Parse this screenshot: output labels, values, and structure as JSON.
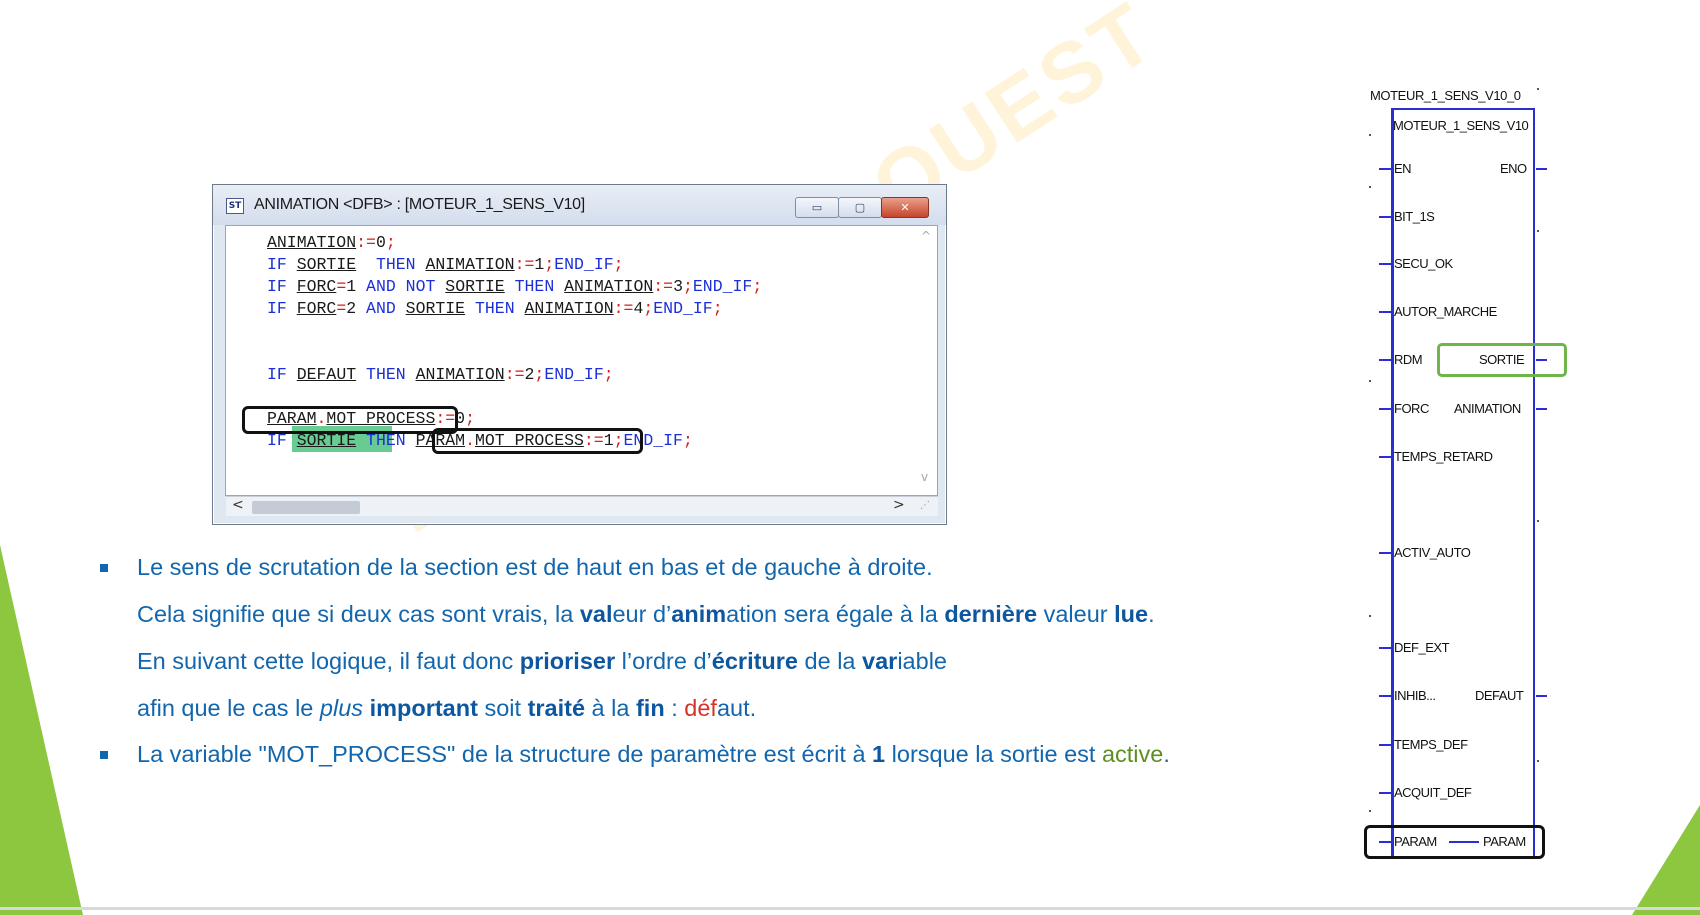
{
  "window": {
    "title": "ANIMATION <DFB> : [MOTEUR_1_SENS_V10]",
    "icon": "st-language-icon",
    "buttons": {
      "minimize": "▭",
      "maximize": "▢",
      "close": "✕"
    }
  },
  "code": {
    "line1": {
      "a": "ANIMATION",
      "b": ":=",
      "c": "0",
      "d": ";"
    },
    "line2": {
      "k1": "IF",
      "v1": "SORTIE",
      "k2": "THEN",
      "v2": "ANIMATION",
      "o1": ":=",
      "n1": "1",
      "o2": ";",
      "k3": "END_IF",
      "o3": ";"
    },
    "line3": {
      "k1": "IF",
      "v1": "FORC",
      "o1": "=",
      "n1": "1",
      "k2": "AND",
      "k3": "NOT",
      "v2": "SORTIE",
      "k4": "THEN",
      "v3": "ANIMATION",
      "o2": ":=",
      "n2": "3",
      "o3": ";",
      "k5": "END_IF",
      "o4": ";"
    },
    "line4": {
      "k1": "IF",
      "v1": "FORC",
      "o1": "=",
      "n1": "2",
      "k2": "AND",
      "v2": "SORTIE",
      "k3": "THEN",
      "v3": "ANIMATION",
      "o2": ":=",
      "n2": "4",
      "o3": ";",
      "k4": "END_IF",
      "o4": ";"
    },
    "line5": {
      "k1": "IF",
      "v1": "DEFAUT",
      "k2": "THEN",
      "v2": "ANIMATION",
      "o1": ":=",
      "n1": "2",
      "o2": ";",
      "k3": "END_IF",
      "o3": ";"
    },
    "line6": {
      "v1": "PARAM",
      "o0": ".",
      "v2": "MOT_PROCESS",
      "o1": ":=",
      "n1": "0",
      "o2": ";"
    },
    "line7": {
      "k1": "IF",
      "v1": "SORTIE",
      "k2": "THEN",
      "v2": "PARAM",
      "o0": ".",
      "v3": "MOT_PROCESS",
      "o1": ":=",
      "n1": "1",
      "o2": ";",
      "k3": "END_IF",
      "o3": ";"
    }
  },
  "scroll": {
    "left": "<",
    "right": ">",
    "up": "^",
    "down": "v"
  },
  "watermark": "FORMATION OUEST",
  "bullets": {
    "b1": {
      "l1": "Le sens de scrutation de la section est de haut en bas et de gauche à droite.",
      "l2": {
        "t1": "Cela signifie que si deux cas sont vrais, la ",
        "b1": "val",
        "t2": "eur d’",
        "b2": "anim",
        "t3": "ation sera égale à la ",
        "b3": "dernière",
        "t4": " valeur ",
        "b4": "lue",
        "t5": "."
      },
      "l3": {
        "t1": "En suivant cette logique, il faut donc ",
        "b1": "prioriser",
        "t2": " l’ordre d’",
        "b2": "écriture",
        "t3": " de la ",
        "b3": "var",
        "t4": "iable"
      },
      "l4": {
        "t1": "afin que le cas le ",
        "i1": "plus",
        "t2": " ",
        "b1": "important",
        "t3": " soit ",
        "b2": "traité",
        "t4": " à la ",
        "b3": "fin",
        "t5": " : ",
        "r1": "déf",
        "t6": "aut."
      }
    },
    "b2": {
      "t1": "La variable \"MOT_PROCESS\" de la structure de paramètre est écrit à ",
      "b1": "1",
      "t2": " lorsque la sortie est ",
      "g1": "active",
      "t3": "."
    }
  },
  "function_block": {
    "instance": "MOTEUR_1_SENS_V10_0",
    "type": "MOTEUR_1_SENS_V10",
    "inputs": [
      "EN",
      "BIT_1S",
      "SECU_OK",
      "AUTOR_MARCHE",
      "RDM",
      "FORC",
      "TEMPS_RETARD",
      "ACTIV_AUTO",
      "DEF_EXT",
      "INHIB...",
      "TEMPS_DEF",
      "ACQUIT_DEF",
      "PARAM"
    ],
    "outputs": [
      "ENO",
      "SORTIE",
      "ANIMATION",
      "DEFAUT",
      "PARAM"
    ]
  },
  "colors": {
    "keyword": "#1b2fd8",
    "operator": "#d21f1f",
    "text_blue": "#1266ad",
    "block_border": "#2a2fd1",
    "accent_green": "#8dc63f"
  }
}
